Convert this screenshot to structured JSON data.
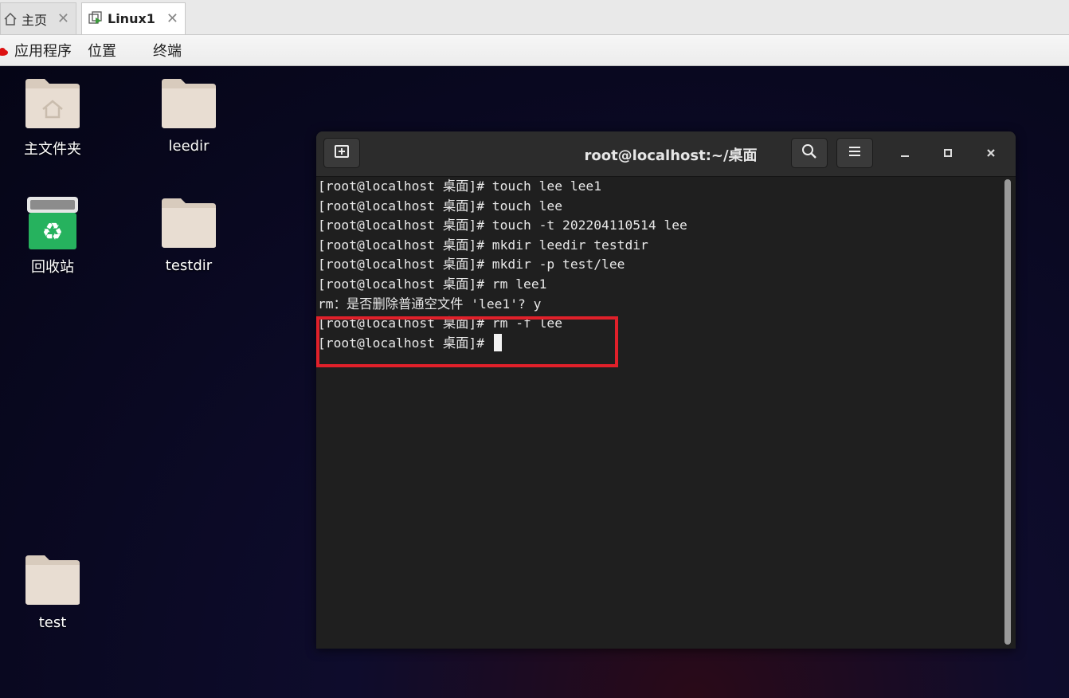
{
  "vm_tabs": {
    "home": {
      "label": "主页",
      "icon": "home-icon"
    },
    "vm": {
      "label": "Linux1",
      "icon": "vm-icon"
    },
    "close_glyph": "✕"
  },
  "topbar": {
    "applications": "应用程序",
    "places": "位置",
    "terminal": "终端"
  },
  "desktop": {
    "icons": [
      {
        "label": "主文件夹",
        "icon": "home-folder-icon"
      },
      {
        "label": "leedir",
        "icon": "folder-icon"
      },
      {
        "label": "回收站",
        "icon": "trash-icon"
      },
      {
        "label": "testdir",
        "icon": "folder-icon"
      },
      {
        "label": "test",
        "icon": "folder-icon"
      }
    ]
  },
  "terminal": {
    "title": "root@localhost:~/桌面",
    "lines": [
      "[root@localhost 桌面]# touch lee lee1",
      "[root@localhost 桌面]# touch lee",
      "[root@localhost 桌面]# touch -t 202204110514 lee",
      "[root@localhost 桌面]# mkdir leedir testdir",
      "[root@localhost 桌面]# mkdir -p test/lee",
      "[root@localhost 桌面]# rm lee1",
      "rm：是否删除普通空文件 'lee1'? y",
      "[root@localhost 桌面]# rm -f lee",
      "[root@localhost 桌面]# "
    ]
  },
  "colors": {
    "highlight": "#e0202a",
    "terminal_bg": "#1f1f1f",
    "folder": "#e8ddd2"
  }
}
